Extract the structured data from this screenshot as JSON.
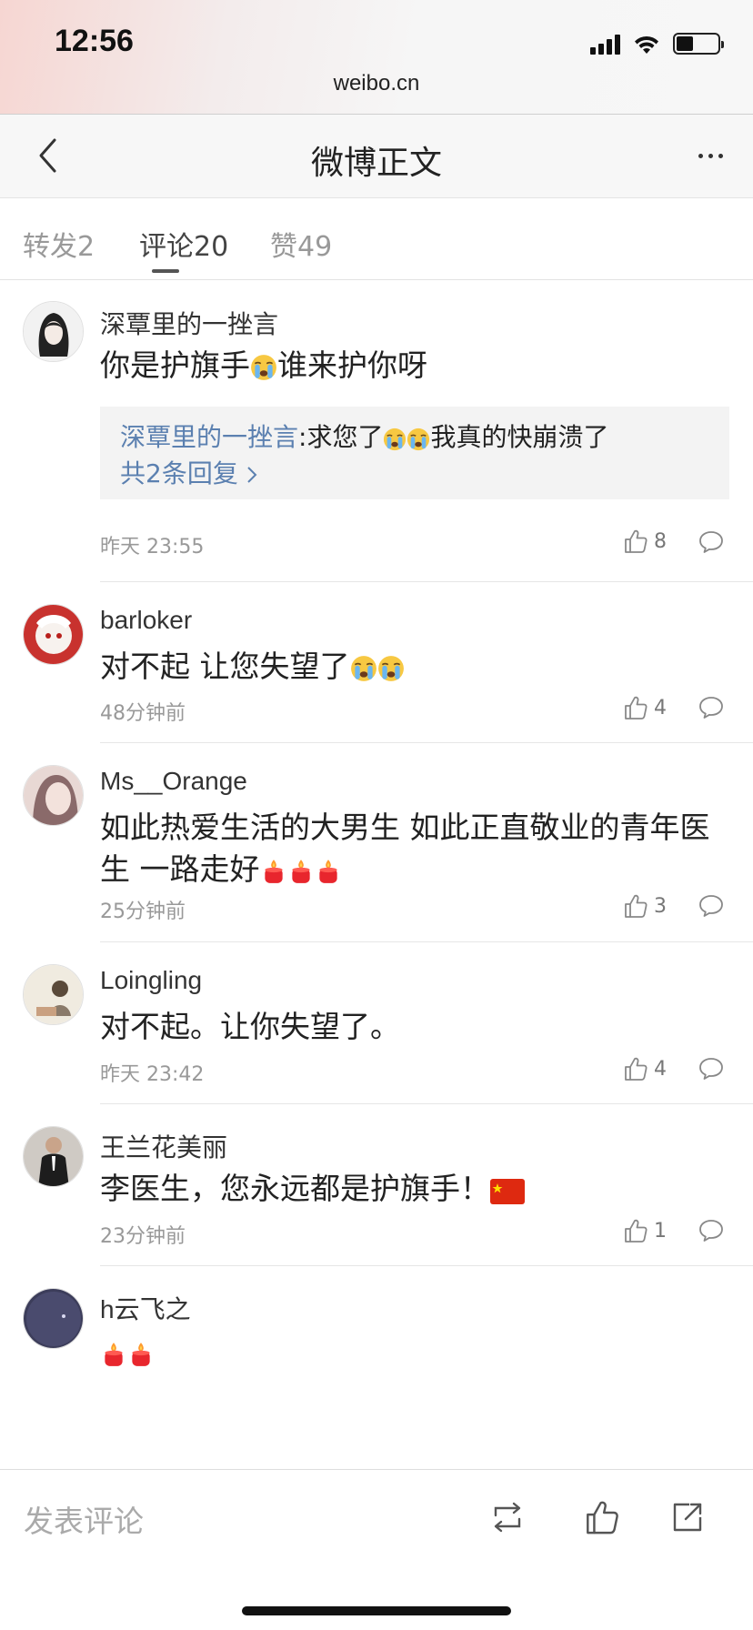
{
  "status_bar": {
    "time": "12:56",
    "domain": "weibo.cn"
  },
  "nav": {
    "title": "微博正文",
    "back_icon": "chevron-left-icon",
    "more_icon": "more-dots-icon"
  },
  "tabs": [
    {
      "label": "转发2",
      "active": false
    },
    {
      "label": "评论20",
      "active": true
    },
    {
      "label": "赞49",
      "active": false
    }
  ],
  "comments": [
    {
      "name": "深覃里的一挫言",
      "text": "你是护旗手",
      "text_after_emoji": "谁来护你呀",
      "reply": {
        "author": "深覃里的一挫言",
        "text": ":求您了",
        "text_after": "我真的快崩溃了",
        "more": "共2条回复"
      },
      "time": "昨天 23:55",
      "likes": "8"
    },
    {
      "name": "barloker",
      "text": "对不起 让您失望了",
      "time": "48分钟前",
      "likes": "4"
    },
    {
      "name": "Ms__Orange",
      "text": "如此热爱生活的大男生 如此正直敬业的青年医生 一路走好",
      "time": "25分钟前",
      "likes": "3"
    },
    {
      "name": "Loingling",
      "text": "对不起。让你失望了。",
      "time": "昨天 23:42",
      "likes": "4"
    },
    {
      "name": "王兰花美丽",
      "text": "李医生，您永远都是护旗手！",
      "time": "23分钟前",
      "likes": "1"
    },
    {
      "name": "h云飞之",
      "text": "",
      "time": "",
      "likes": ""
    }
  ],
  "bottom_bar": {
    "placeholder": "发表评论"
  },
  "colors": {
    "link": "#5b80b0",
    "muted": "#999999",
    "divider": "#e6e6e6"
  }
}
